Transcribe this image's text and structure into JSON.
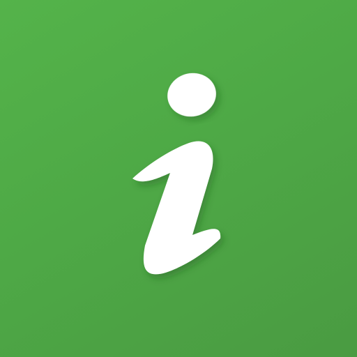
{
  "icon": {
    "name": "info-icon",
    "background_colors": [
      "#54b34a",
      "#4ea946",
      "#4a9b42"
    ],
    "glyph_color": "#ffffff"
  }
}
